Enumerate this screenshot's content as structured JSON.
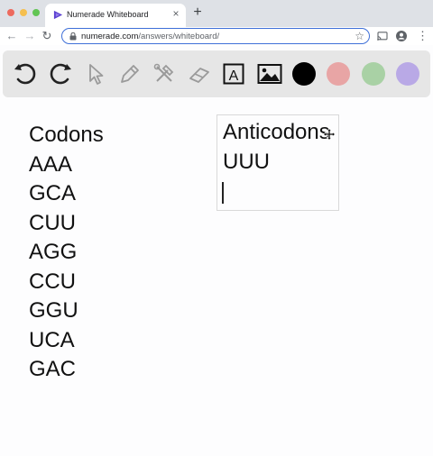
{
  "browser": {
    "tab_title": "Numerade Whiteboard",
    "tab_close": "×",
    "new_tab": "+",
    "url_domain": "numerade.com",
    "url_path": "/answers/whiteboard/",
    "nav_back": "←",
    "nav_forward": "→",
    "nav_reload": "↻",
    "bookmark_star": "☆",
    "menu": "⋮"
  },
  "toolbar": {
    "tools": [
      "undo-icon",
      "redo-icon",
      "select-icon",
      "pen-icon",
      "tools-icon",
      "eraser-icon",
      "text-tool-icon",
      "image-icon"
    ],
    "text_tool_glyph": "A",
    "colors": [
      "#000000",
      "#e8a5a5",
      "#a9d1a5",
      "#b9a9e6"
    ]
  },
  "canvas": {
    "codons": [
      "Codons",
      "AAA",
      "GCA",
      "CUU",
      "AGG",
      "CCU",
      "GGU",
      "UCA",
      "GAC"
    ],
    "anticodons": [
      "Anticodons",
      "UUU"
    ]
  }
}
